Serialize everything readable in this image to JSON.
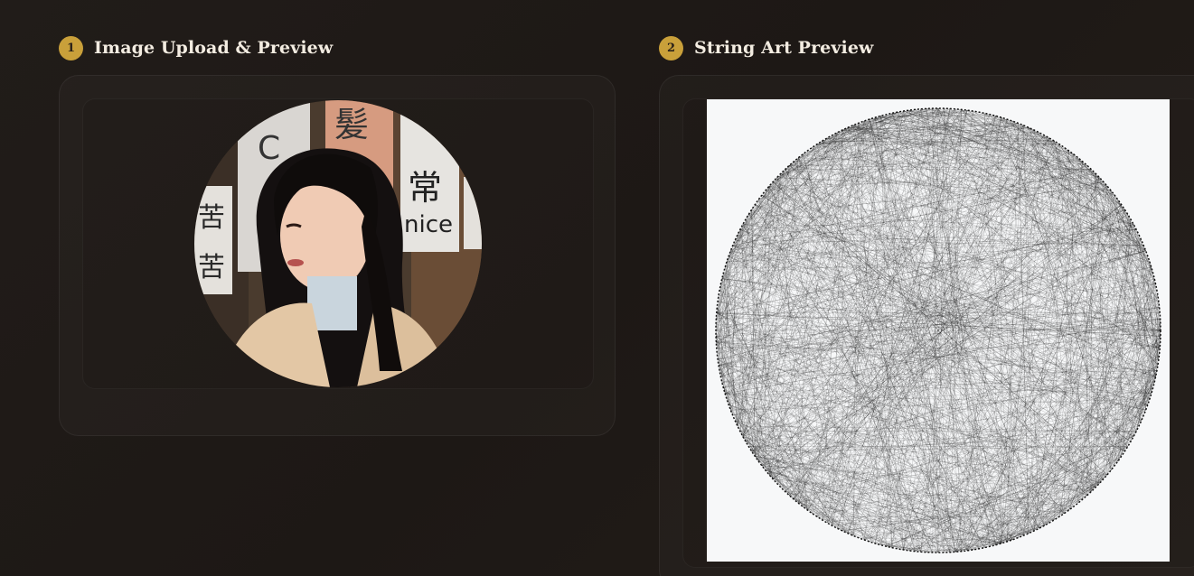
{
  "sections": [
    {
      "number": "1",
      "title": "Image Upload & Preview"
    },
    {
      "number": "2",
      "title": "String Art Preview"
    }
  ],
  "upload_preview": {
    "image_description": "circular cropped portrait photo",
    "sign_text": [
      "nice"
    ]
  },
  "string_art": {
    "background_color": "#f7f8f9",
    "thread_color": "#000000"
  },
  "colors": {
    "accent": "#c9a03a",
    "page_background": "#1f1a17",
    "title_text": "#f3ece1"
  }
}
